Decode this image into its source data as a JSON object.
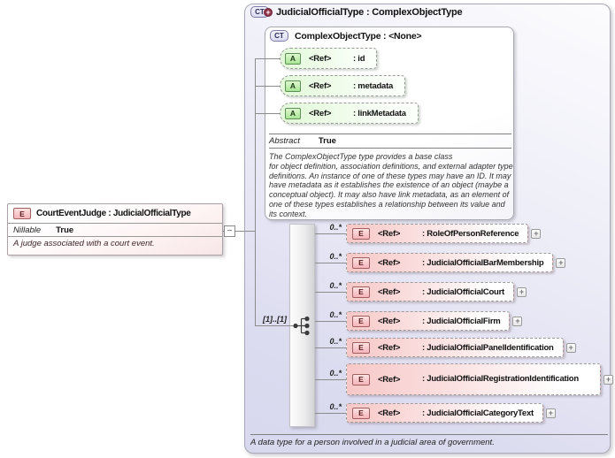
{
  "colors": {
    "type_box_fill": "#dcdcf0",
    "element_fill": "#f7c7c7",
    "attribute_fill": "#e2f9d9",
    "badge_maroon": "#8d3247",
    "border_gray": "#9a9a9a"
  },
  "icons": {
    "element_letter": "E",
    "attribute_letter": "A",
    "complex_type_label": "CT",
    "complex_type_plus": "+",
    "collapse_minus": "−",
    "expand_plus": "+"
  },
  "left_element": {
    "title": "CourtEventJudge : JudicialOfficialType",
    "properties": [
      {
        "name": "Nillable",
        "value": "True"
      }
    ],
    "annotation": "A judge associated with a court event."
  },
  "type_box": {
    "title": "JudicialOfficialType : ComplexObjectType",
    "annotation": "A data type for a person involved in a judicial area of government.",
    "base_type": {
      "title": "ComplexObjectType : <None>",
      "attributes": [
        {
          "ref": "<Ref>",
          "name": ": id"
        },
        {
          "ref": "<Ref>",
          "name": ": metadata"
        },
        {
          "ref": "<Ref>",
          "name": ": linkMetadata"
        }
      ],
      "properties": [
        {
          "name": "Abstract",
          "value": "True"
        }
      ],
      "annotation": "The ComplexObjectType type provides a base class\nfor object definition, association definitions, and external adapter type definitions. An instance of one of these types may have an ID. It may have metadata as it establishes the existence of an object (maybe a conceptual object). It may also have link metadata, as an element of one of these types establishes a relationship between its value and its context."
    },
    "sequence": {
      "cardinality": "[1]..[1]"
    },
    "elements": [
      {
        "cardinality": "0..*",
        "ref": "<Ref>",
        "name": ": RoleOfPersonReference"
      },
      {
        "cardinality": "0..*",
        "ref": "<Ref>",
        "name": ": JudicialOfficialBarMembership"
      },
      {
        "cardinality": "0..*",
        "ref": "<Ref>",
        "name": ": JudicialOfficialCourt"
      },
      {
        "cardinality": "0..*",
        "ref": "<Ref>",
        "name": ": JudicialOfficialFirm"
      },
      {
        "cardinality": "0..*",
        "ref": "<Ref>",
        "name": ": JudicialOfficialPanelIdentification"
      },
      {
        "cardinality": "0..*",
        "ref": "<Ref>",
        "name": ": JudicialOfficialRegistrationIdentification"
      },
      {
        "cardinality": "0..*",
        "ref": "<Ref>",
        "name": ": JudicialOfficialCategoryText"
      }
    ]
  }
}
